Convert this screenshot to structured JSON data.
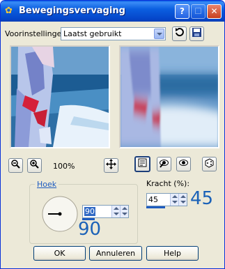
{
  "window": {
    "title": "Bewegingsvervaging",
    "help_label": "?",
    "close_label": "✕",
    "icon": "paintshop-icon"
  },
  "presets": {
    "label": "Voorinstellingen:",
    "value": "Laatst gebruikt"
  },
  "zoom": {
    "level": "100%"
  },
  "angle": {
    "group_label": "Hoek",
    "value": "90",
    "overlay_value": "90"
  },
  "strength": {
    "label": "Kracht (%):",
    "value": "45",
    "overlay_value": "45"
  },
  "buttons": {
    "ok": "OK",
    "cancel": "Annuleren",
    "help": "Help"
  },
  "colors": {
    "accent_blue": "#1b62b8",
    "title_blue": "#0a5fe6"
  }
}
